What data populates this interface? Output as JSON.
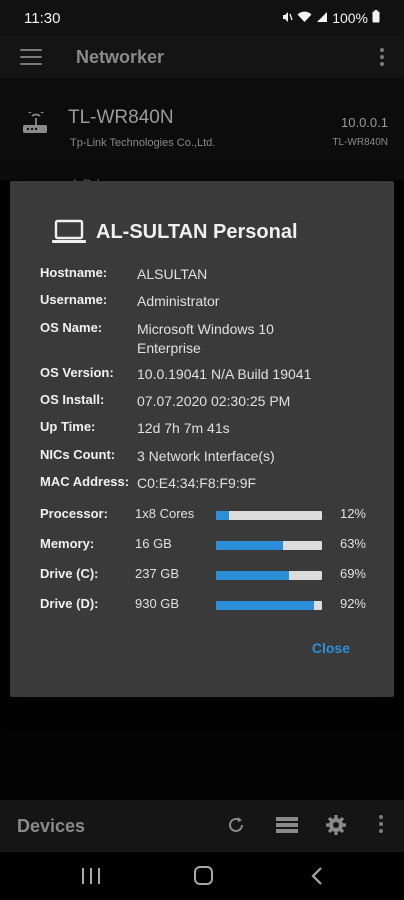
{
  "status_bar": {
    "time": "11:30",
    "battery": "100%",
    "icons": [
      "mute-icon",
      "wifi-icon",
      "signal-icon",
      "battery-icon"
    ]
  },
  "app_bar": {
    "title": "Networker"
  },
  "router": {
    "name": "TL-WR840N",
    "vendor": "Tp-Link Technologies Co.,Ltd.",
    "ip": "10.0.0.1",
    "model": "TL-WR840N",
    "partial_text": "A    D    l"
  },
  "dialog": {
    "title": "AL-SULTAN Personal",
    "info": [
      {
        "label": "Hostname:",
        "value": "ALSULTAN"
      },
      {
        "label": "Username:",
        "value": "Administrator"
      },
      {
        "label": "OS Name:",
        "value": "Microsoft Windows 10 Enterprise"
      },
      {
        "label": "OS Version:",
        "value": "10.0.19041 N/A Build 19041"
      },
      {
        "label": "OS Install:",
        "value": "07.07.2020 02:30:25 PM"
      },
      {
        "label": "Up Time:",
        "value": "12d 7h 7m 41s"
      },
      {
        "label": "NICs Count:",
        "value": "3 Network Interface(s)"
      },
      {
        "label": "MAC Address:",
        "value": "C0:E4:34:F8:F9:9F"
      }
    ],
    "resources": [
      {
        "label": "Processor:",
        "value": "1x8 Cores",
        "percent": 12,
        "percent_text": "12%"
      },
      {
        "label": "Memory:",
        "value": "16 GB",
        "percent": 63,
        "percent_text": "63%"
      },
      {
        "label": "Drive (C):",
        "value": "237 GB",
        "percent": 69,
        "percent_text": "69%"
      },
      {
        "label": "Drive (D):",
        "value": "930 GB",
        "percent": 92,
        "percent_text": "92%"
      }
    ],
    "close_label": "Close"
  },
  "bottom_bar": {
    "title": "Devices",
    "icons": [
      "refresh-icon",
      "list-icon",
      "gear-icon",
      "overflow-icon"
    ]
  },
  "colors": {
    "accent": "#2a8fd8",
    "dialog_bg": "#3a3a3a",
    "bar_bg": "#dcdcdc"
  }
}
